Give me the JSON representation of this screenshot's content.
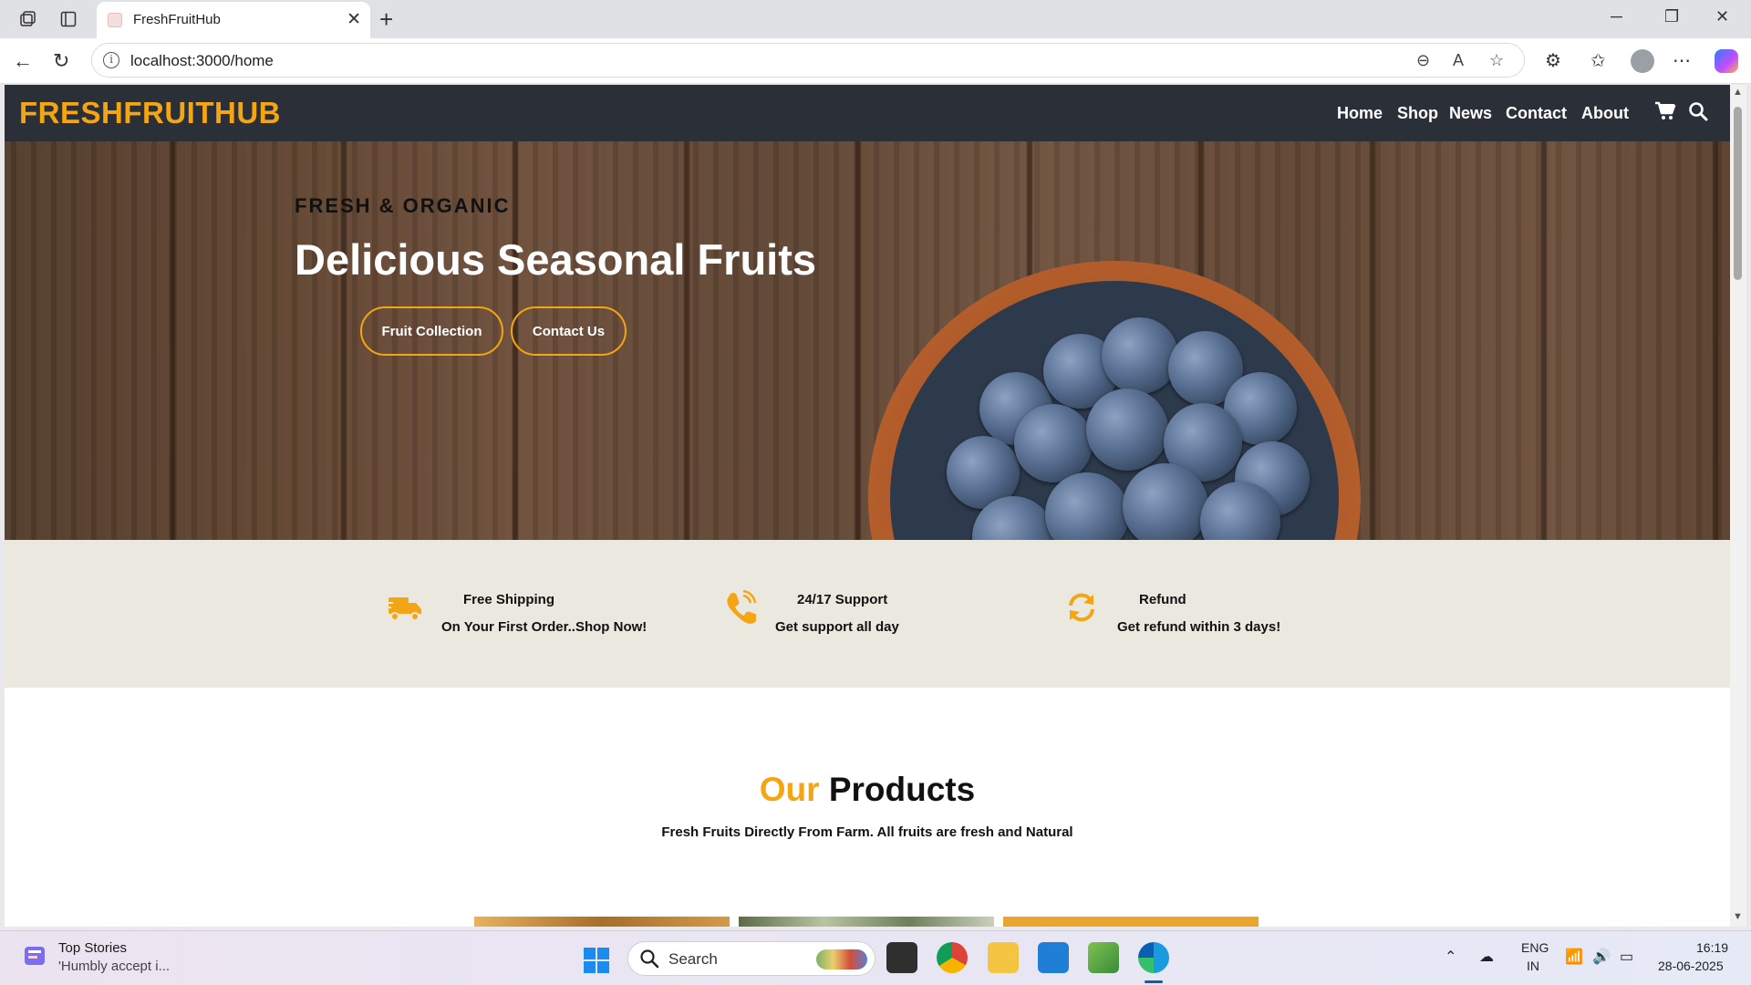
{
  "browser": {
    "tab_title": "FreshFruitHub",
    "url": "localhost:3000/home"
  },
  "site": {
    "logo": "FRESHFRUITHUB",
    "nav": [
      "Home",
      "Shop",
      "News",
      "Contact",
      "About"
    ]
  },
  "hero": {
    "subtitle": "FRESH & ORGANIC",
    "title": "Delicious Seasonal Fruits",
    "buttons": [
      "Fruit Collection",
      "Contact Us"
    ]
  },
  "features": [
    {
      "icon": "truck-icon",
      "title": "Free Shipping",
      "subtitle": "On Your First Order..Shop Now!"
    },
    {
      "icon": "phone-icon",
      "title": "24/17 Support",
      "subtitle": "Get support all day"
    },
    {
      "icon": "refresh-icon",
      "title": "Refund",
      "subtitle": "Get refund within 3 days!"
    }
  ],
  "products": {
    "heading_accent": "Our",
    "heading_rest": "Products",
    "subtitle": "Fresh Fruits Directly From Farm. All fruits are fresh and Natural"
  },
  "taskbar": {
    "news_title": "Top Stories",
    "news_subtitle": "'Humbly accept i...",
    "search_label": "Search",
    "lang_top": "ENG",
    "lang_bottom": "IN",
    "time": "16:19",
    "date": "28-06-2025"
  },
  "colors": {
    "accent": "#f3a513",
    "header_bg": "#2b3038",
    "features_bg": "#ebe8df"
  }
}
